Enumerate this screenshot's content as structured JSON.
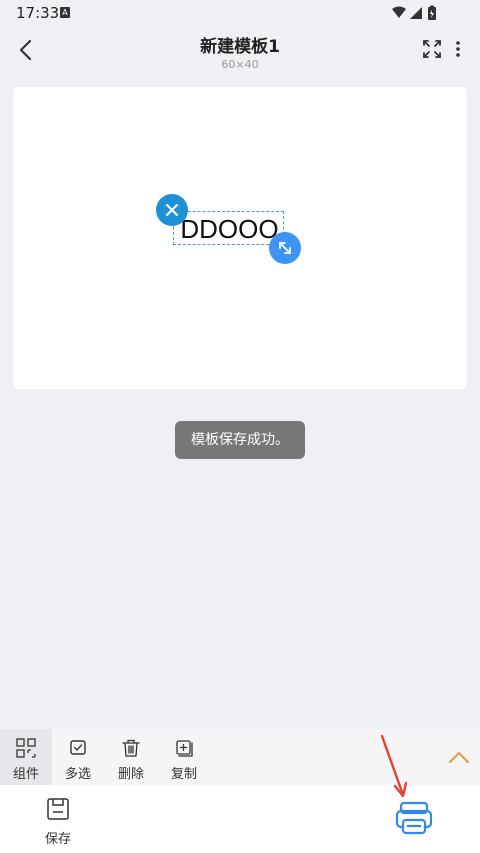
{
  "status_bar": {
    "time": "17:33",
    "notification_icon": "A"
  },
  "header": {
    "title": "新建模板1",
    "subtitle": "60×40"
  },
  "canvas": {
    "text_element": "DDOOO"
  },
  "toast": {
    "message": "模板保存成功。"
  },
  "toolbar": {
    "items": [
      {
        "label": "组件",
        "icon": "components-icon"
      },
      {
        "label": "多选",
        "icon": "checkbox-icon"
      },
      {
        "label": "删除",
        "icon": "trash-icon"
      },
      {
        "label": "复制",
        "icon": "copy-icon"
      }
    ],
    "collapse_icon": "chevron-up-icon"
  },
  "bottom_bar": {
    "save_label": "保存",
    "print_icon": "printer-icon"
  },
  "colors": {
    "accent": "#3b94f6",
    "annotation_arrow": "#e8402e",
    "chevron": "#e0a040"
  }
}
